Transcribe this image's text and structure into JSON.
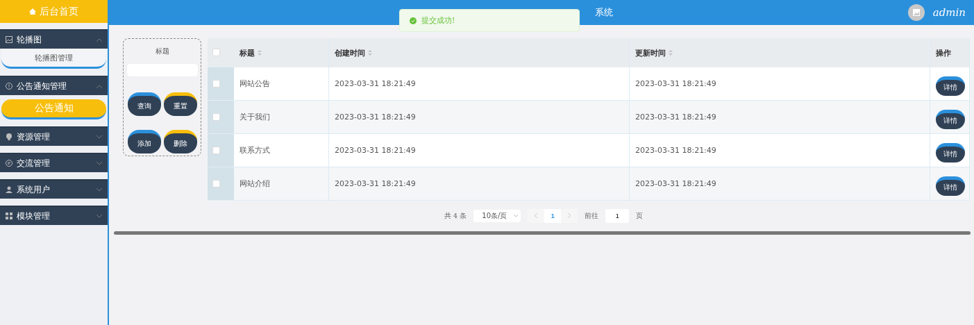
{
  "sidebar": {
    "home": "后台首页",
    "menus": [
      {
        "label": "轮播图",
        "expanded": true,
        "children": [
          {
            "label": "轮播图管理",
            "selected": false
          }
        ]
      },
      {
        "label": "公告通知管理",
        "expanded": true,
        "children": [
          {
            "label": "公告通知",
            "selected": true
          }
        ]
      },
      {
        "label": "资源管理",
        "expanded": false
      },
      {
        "label": "交流管理",
        "expanded": false
      },
      {
        "label": "系统用户",
        "expanded": false
      },
      {
        "label": "模块管理",
        "expanded": false
      }
    ]
  },
  "header": {
    "title": "系统",
    "user": "admin"
  },
  "toast": {
    "message": "提交成功!"
  },
  "search": {
    "label": "标题",
    "buttons": [
      {
        "label": "查询",
        "kind": "primary"
      },
      {
        "label": "重置",
        "kind": "warning"
      },
      {
        "label": "添加",
        "kind": "primary"
      },
      {
        "label": "删除",
        "kind": "warning"
      }
    ]
  },
  "table": {
    "all_checked": false,
    "columns": [
      {
        "label": "标题",
        "sortable": true
      },
      {
        "label": "创建时间",
        "sortable": true
      },
      {
        "label": "更新时间",
        "sortable": true
      },
      {
        "label": "操作",
        "sortable": false
      }
    ],
    "rows": [
      {
        "checked": false,
        "title": "网站公告",
        "created": "2023-03-31 18:21:49",
        "updated": "2023-03-31 18:21:49",
        "action": "详情"
      },
      {
        "checked": false,
        "title": "关于我们",
        "created": "2023-03-31 18:21:49",
        "updated": "2023-03-31 18:21:49",
        "action": "详情"
      },
      {
        "checked": false,
        "title": "联系方式",
        "created": "2023-03-31 18:21:49",
        "updated": "2023-03-31 18:21:49",
        "action": "详情"
      },
      {
        "checked": false,
        "title": "网站介绍",
        "created": "2023-03-31 18:21:49",
        "updated": "2023-03-31 18:21:49",
        "action": "详情"
      }
    ]
  },
  "pagination": {
    "total": "共 4 条",
    "page_size": "10条/页",
    "pages": [
      {
        "label": "1",
        "selected": true
      }
    ],
    "goto": "前往",
    "goto_value": "1",
    "page_unit": "页"
  }
}
